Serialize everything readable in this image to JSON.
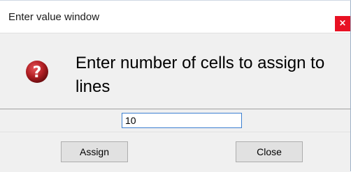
{
  "window": {
    "title": "Enter value window",
    "close_glyph": "×"
  },
  "message": {
    "icon": "question-icon",
    "text": "Enter number of cells to assign to lines"
  },
  "input": {
    "value": "10"
  },
  "buttons": {
    "assign_label": "Assign",
    "close_label": "Close"
  },
  "colors": {
    "close_button": "#e81123",
    "icon_red": "#b01e23",
    "panel_bg": "#f0f0f0",
    "input_border": "#3c7fd1"
  }
}
